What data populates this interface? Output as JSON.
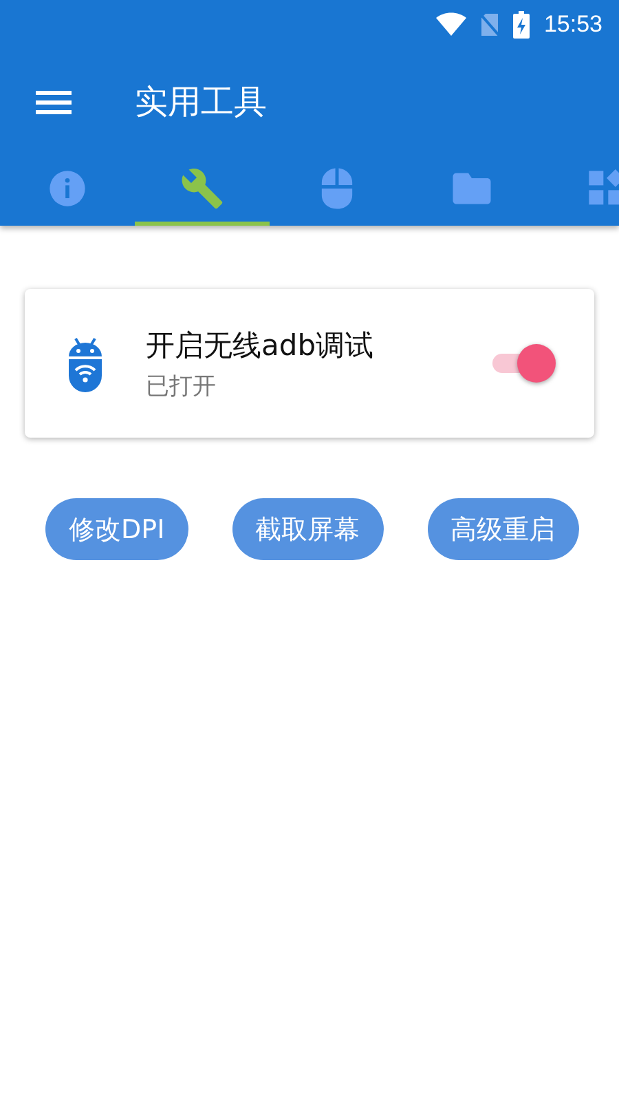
{
  "status_bar": {
    "time": "15:53"
  },
  "toolbar": {
    "title": "实用工具"
  },
  "tabs": [
    {
      "kind": "info",
      "selected": false
    },
    {
      "kind": "wrench",
      "selected": true
    },
    {
      "kind": "mouse",
      "selected": false
    },
    {
      "kind": "folder",
      "selected": false
    },
    {
      "kind": "apps",
      "selected": false
    }
  ],
  "card": {
    "title": "开启无线adb调试",
    "subtitle": "已打开",
    "on": true
  },
  "buttons": [
    "修改DPI",
    "截取屏幕",
    "高级重启"
  ]
}
